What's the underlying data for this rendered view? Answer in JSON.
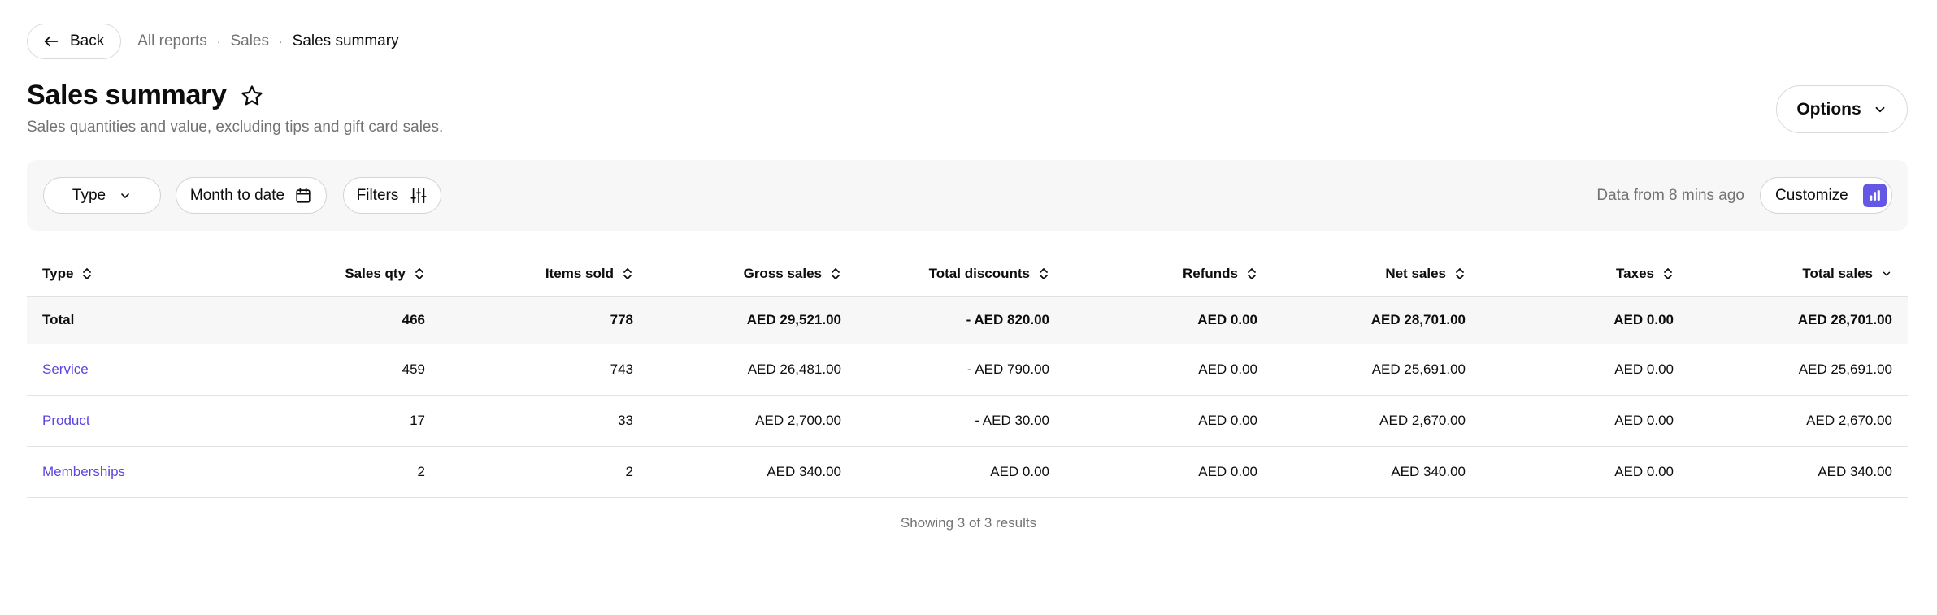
{
  "nav": {
    "back_label": "Back",
    "breadcrumbs": [
      "All reports",
      "Sales",
      "Sales summary"
    ],
    "separator": "·"
  },
  "header": {
    "title": "Sales summary",
    "subtitle": "Sales quantities and value, excluding tips and gift card sales.",
    "options_label": "Options"
  },
  "filters": {
    "type_label": "Type",
    "date_label": "Month to date",
    "filters_label": "Filters",
    "data_freshness": "Data from 8 mins ago",
    "customize_label": "Customize",
    "accent_color": "#6457e6"
  },
  "table": {
    "columns": [
      "Type",
      "Sales qty",
      "Items sold",
      "Gross sales",
      "Total discounts",
      "Refunds",
      "Net sales",
      "Taxes",
      "Total sales"
    ],
    "total": [
      "Total",
      "466",
      "778",
      "AED 29,521.00",
      "- AED 820.00",
      "AED 0.00",
      "AED 28,701.00",
      "AED 0.00",
      "AED 28,701.00"
    ],
    "rows": [
      [
        "Service",
        "459",
        "743",
        "AED 26,481.00",
        "- AED 790.00",
        "AED 0.00",
        "AED 25,691.00",
        "AED 0.00",
        "AED 25,691.00"
      ],
      [
        "Product",
        "17",
        "33",
        "AED 2,700.00",
        "- AED 30.00",
        "AED 0.00",
        "AED 2,670.00",
        "AED 0.00",
        "AED 2,670.00"
      ],
      [
        "Memberships",
        "2",
        "2",
        "AED 340.00",
        "AED 0.00",
        "AED 0.00",
        "AED 340.00",
        "AED 0.00",
        "AED 340.00"
      ]
    ],
    "link_color": "#5b47e0",
    "results_text": "Showing 3 of 3 results"
  }
}
